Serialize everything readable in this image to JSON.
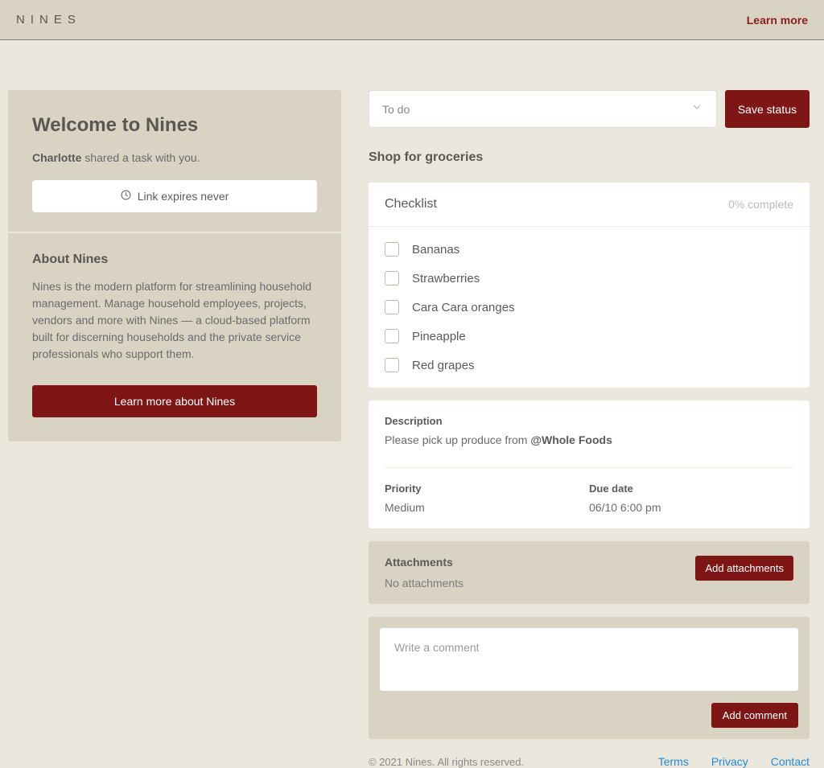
{
  "header": {
    "logo": "NINES",
    "learn_more": "Learn more"
  },
  "sidebar": {
    "welcome": {
      "title": "Welcome to Nines",
      "shared_by_name": "Charlotte",
      "shared_by_suffix": " shared a task with you.",
      "expiry": "Link expires never"
    },
    "about": {
      "title": "About Nines",
      "text": "Nines is the modern platform for streamlining household management. Manage household employees, projects, vendors and more with Nines — a cloud-based platform built for discerning households and the private service professionals who support them.",
      "cta": "Learn more about Nines"
    }
  },
  "task": {
    "status_selected": "To do",
    "save_button": "Save status",
    "title": "Shop for groceries",
    "checklist": {
      "label": "Checklist",
      "progress": "0% complete",
      "items": [
        "Bananas",
        "Strawberries",
        "Cara Cara oranges",
        "Pineapple",
        "Red grapes"
      ]
    },
    "description": {
      "label": "Description",
      "text_prefix": "Please pick up produce from ",
      "mention": "@Whole Foods"
    },
    "priority": {
      "label": "Priority",
      "value": "Medium"
    },
    "due_date": {
      "label": "Due date",
      "value": "06/10 6:00 pm"
    },
    "attachments": {
      "label": "Attachments",
      "empty": "No attachments",
      "add_button": "Add attachments"
    },
    "comment": {
      "placeholder": "Write a comment",
      "add_button": "Add comment"
    }
  },
  "footer": {
    "copyright": "© 2021 Nines. All rights reserved.",
    "links": [
      "Terms",
      "Privacy",
      "Contact"
    ]
  }
}
